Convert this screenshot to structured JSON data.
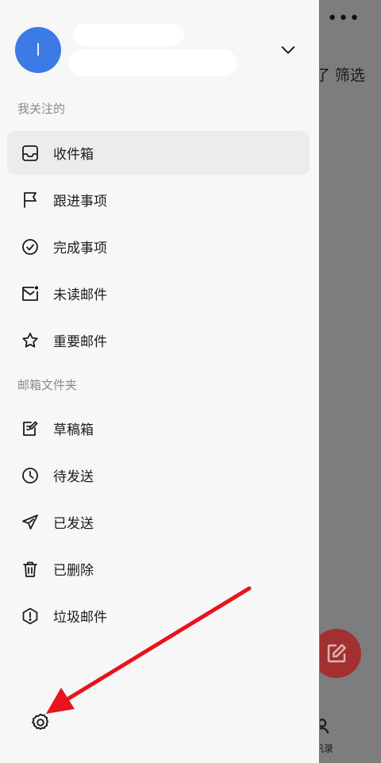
{
  "background": {
    "more_label": "•••",
    "filter_label": "了 筛选",
    "contacts_label": "讯录"
  },
  "account": {
    "avatar_letter": "l"
  },
  "sections": {
    "following": "我关注的",
    "folders": "邮箱文件夹"
  },
  "following_items": [
    {
      "label": "收件箱",
      "icon": "inbox-icon"
    },
    {
      "label": "跟进事项",
      "icon": "flag-icon"
    },
    {
      "label": "完成事项",
      "icon": "check-circle-icon"
    },
    {
      "label": "未读邮件",
      "icon": "unread-mail-icon"
    },
    {
      "label": "重要邮件",
      "icon": "star-icon"
    }
  ],
  "folder_items": [
    {
      "label": "草稿箱",
      "icon": "draft-icon"
    },
    {
      "label": "待发送",
      "icon": "clock-icon"
    },
    {
      "label": "已发送",
      "icon": "send-icon"
    },
    {
      "label": "已删除",
      "icon": "trash-icon"
    },
    {
      "label": "垃圾邮件",
      "icon": "spam-icon"
    }
  ],
  "colors": {
    "avatar": "#3c7be6",
    "annotation_arrow": "#e8141b",
    "fab": "#a23030"
  }
}
